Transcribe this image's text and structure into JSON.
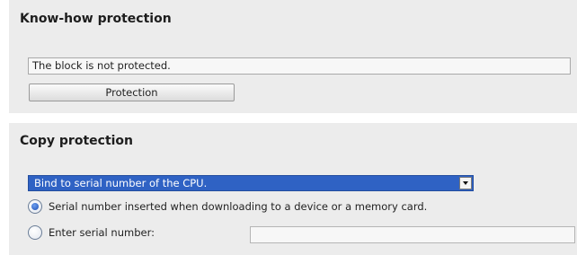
{
  "know_how": {
    "title": "Know-how protection",
    "status_text": "The block is not protected.",
    "protection_button_label": "Protection"
  },
  "copy_protection": {
    "title": "Copy protection",
    "select": {
      "selected": "Bind to serial number of the CPU."
    },
    "options": [
      {
        "label": "Serial number inserted when downloading to a device or a memory card.",
        "checked": true
      },
      {
        "label": "Enter serial number:",
        "checked": false
      }
    ],
    "serial_input": {
      "value": ""
    }
  },
  "colors": {
    "panel_bg": "#ececec",
    "select_bg": "#2f62c4",
    "radio_accent": "#1c4fb5"
  }
}
